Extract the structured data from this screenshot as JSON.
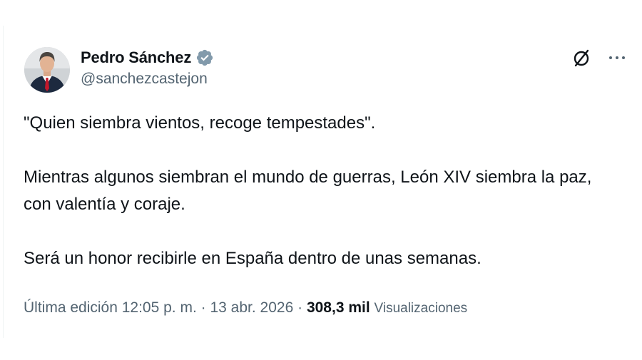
{
  "author": {
    "display_name": "Pedro Sánchez",
    "handle": "@sanchezcastejon",
    "verified": true,
    "verified_color": "#829aab"
  },
  "actions": {
    "grok_icon": "slashed-circle-icon",
    "more_icon": "more-dots-icon"
  },
  "tweet": {
    "paragraphs": [
      "\"Quien siembra vientos, recoge tempestades\".",
      "Mientras algunos siembran el mundo de guerras, León XIV siembra la paz, con valentía y coraje.",
      "Será un honor recibirle en España dentro de unas semanas."
    ]
  },
  "meta": {
    "edited_label": "Última edición",
    "time": "12:05 p. m.",
    "separator": "·",
    "date": "13 abr. 2026",
    "views_count": "308,3 mil",
    "views_label": "Visualizaciones"
  },
  "colors": {
    "text_primary": "#0f1419",
    "text_secondary": "#536471",
    "divider": "#eff3f4"
  }
}
